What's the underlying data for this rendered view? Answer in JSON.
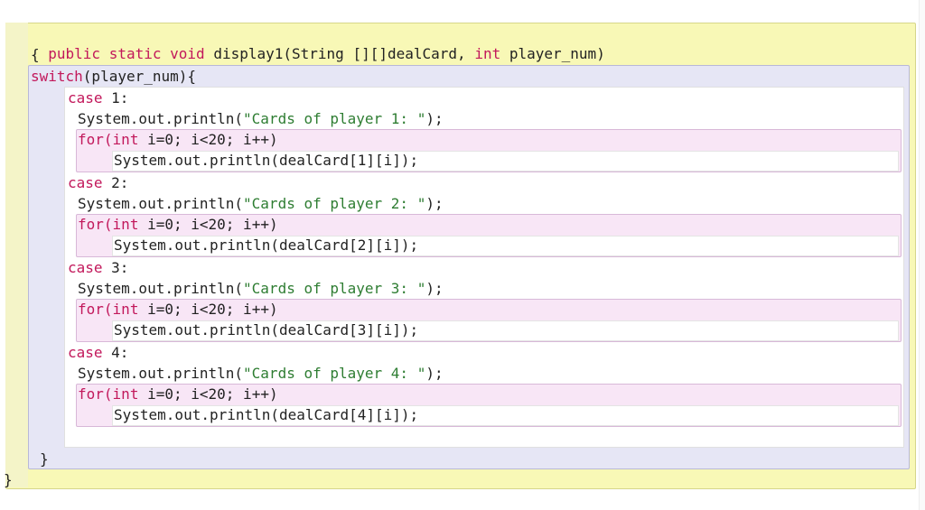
{
  "method": {
    "signature": {
      "kw_public": "public",
      "kw_static": "static",
      "kw_void": "void",
      "name_part": "display1(String [][]dealCard,",
      "kw_int": "int",
      "param": "player_num)"
    },
    "open_brace": "{",
    "close_brace": "}"
  },
  "switch": {
    "kw_switch": "switch",
    "header_rest": "(player_num){",
    "close_brace": "}",
    "cases": [
      {
        "kw_case": "case",
        "label": "1:",
        "println_prefix": "System.out.println(",
        "println_string": "\"Cards of player 1: \"",
        "println_suffix": ");",
        "for_kw": "for",
        "for_paren": "(",
        "for_int": "int",
        "for_rest": "i=0; i<20; i++)",
        "body": "System.out.println(dealCard[1][i]);"
      },
      {
        "kw_case": "case",
        "label": "2:",
        "println_prefix": "System.out.println(",
        "println_string": "\"Cards of player 2: \"",
        "println_suffix": ");",
        "for_kw": "for",
        "for_paren": "(",
        "for_int": "int",
        "for_rest": "i=0; i<20; i++)",
        "body": "System.out.println(dealCard[2][i]);"
      },
      {
        "kw_case": "case",
        "label": "3:",
        "println_prefix": "System.out.println(",
        "println_string": "\"Cards of player 3: \"",
        "println_suffix": ");",
        "for_kw": "for",
        "for_paren": "(",
        "for_int": "int",
        "for_rest": "i=0; i<20; i++)",
        "body": "System.out.println(dealCard[3][i]);"
      },
      {
        "kw_case": "case",
        "label": "4:",
        "println_prefix": "System.out.println(",
        "println_string": "\"Cards of player 4: \"",
        "println_suffix": ");",
        "for_kw": "for",
        "for_paren": "(",
        "for_int": "int",
        "for_rest": "i=0; i<20; i++)",
        "body": "System.out.println(dealCard[4][i]);"
      }
    ]
  },
  "colors": {
    "keyword": "#c2185b",
    "string": "#2e7d32",
    "method_block": "#f8f8b6",
    "switch_block": "#e6e6f5",
    "for_block": "#f8e6f6"
  }
}
